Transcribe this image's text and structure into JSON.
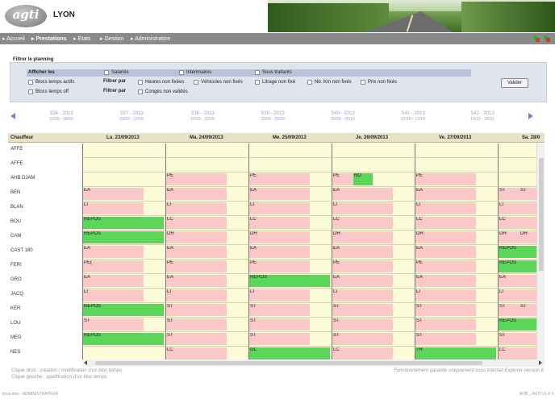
{
  "header": {
    "logo_text": "agti",
    "logo_subtext": "TRANSPORT",
    "city": "LYON"
  },
  "nav": {
    "items": [
      "Accueil",
      "Prestations",
      "Etats",
      "Gestion",
      "Administration"
    ],
    "active": "Prestations"
  },
  "filter": {
    "title": "Filtrer le planning",
    "afficher_label": "Afficher les",
    "filtrer_par_label": "Filtrer par",
    "checkboxes": {
      "salaries": "Salariés",
      "interimaires": "Intérimaires",
      "sous_traitants": "Sous traitants",
      "blocs_actifs": "Blocs temps actifs",
      "blocs_off": "Blocs temps off",
      "heures_non_fixees": "Heures non fixées",
      "vehicules_non_fixes": "Véhicules non fixés",
      "litrage_non_fixe": "Litrage non fixé",
      "km_non_fixes": "Nb. Km non fixés",
      "prix_non_fixes": "Prix non fixés",
      "conges_non_valides": "Congés non validés"
    },
    "valider_label": "Valider"
  },
  "weeks": [
    {
      "label": "S36 - 2013",
      "dates": "02/09 - 08/09"
    },
    {
      "label": "S37 - 2013",
      "dates": "09/09 - 15/09"
    },
    {
      "label": "S38 - 2013",
      "dates": "16/09 - 22/09"
    },
    {
      "label": "S39 - 2013",
      "dates": "23/09 - 29/09"
    },
    {
      "label": "S40 - 2013",
      "dates": "30/09 - 06/10"
    },
    {
      "label": "S41 - 2013",
      "dates": "07/10 - 13/10"
    },
    {
      "label": "S42 - 2013",
      "dates": "14/10 - 20/10"
    }
  ],
  "grid": {
    "chauffeur_header": "Chauffeur",
    "days": [
      "Lu. 23/09/2013",
      "Ma. 24/09/2013",
      "Me. 25/09/2013",
      "Je. 26/09/2013",
      "Ve. 27/09/2013",
      "Sa. 28/0"
    ],
    "chauffeurs": [
      "AFFE",
      "AFFE",
      "AHB DJAM",
      "BEN",
      "BLAN",
      "BOU",
      "CAM",
      "CAST 180",
      "FERI",
      "GRO",
      "JACQ",
      "KER",
      "LOU",
      "MEG",
      "NES"
    ],
    "rows": [
      [
        null,
        null,
        null,
        null,
        null,
        null
      ],
      [
        null,
        null,
        null,
        null,
        null,
        null
      ],
      [
        null,
        {
          "text": "PE",
          "color": "pink"
        },
        {
          "text": "PE",
          "color": "pink"
        },
        {
          "text": "PE",
          "color": "pink",
          "extra": {
            "text": "NO",
            "color": "green"
          }
        },
        {
          "text": "PE",
          "color": "pink"
        },
        null
      ],
      [
        {
          "text": "EA",
          "color": "pink"
        },
        {
          "text": "EA",
          "color": "pink"
        },
        {
          "text": "EA",
          "color": "pink"
        },
        {
          "text": "EA",
          "color": "pink"
        },
        {
          "text": "EA",
          "color": "pink"
        },
        {
          "text": "ST",
          "color": "pink",
          "extra": {
            "text": "ST",
            "color": "pink"
          }
        }
      ],
      [
        {
          "text": "LI",
          "color": "pink"
        },
        {
          "text": "LI",
          "color": "pink"
        },
        {
          "text": "LI",
          "color": "pink"
        },
        {
          "text": "LI",
          "color": "pink"
        },
        {
          "text": "LI",
          "color": "pink"
        },
        {
          "text": "LI",
          "color": "pink"
        }
      ],
      [
        {
          "text": "REPOS",
          "color": "green"
        },
        {
          "text": "LC",
          "color": "pink"
        },
        {
          "text": "LC",
          "color": "pink"
        },
        {
          "text": "LC",
          "color": "pink"
        },
        {
          "text": "LC",
          "color": "pink"
        },
        {
          "text": "LC",
          "color": "pink"
        }
      ],
      [
        {
          "text": "REPOS",
          "color": "green"
        },
        {
          "text": "DH",
          "color": "pink"
        },
        {
          "text": "DH",
          "color": "pink"
        },
        {
          "text": "DH",
          "color": "pink"
        },
        {
          "text": "DH",
          "color": "pink"
        },
        {
          "text": "DH",
          "color": "pink",
          "extra": {
            "text": "DH",
            "color": "pink"
          }
        }
      ],
      [
        {
          "text": "EA",
          "color": "pink"
        },
        {
          "text": "EA",
          "color": "pink"
        },
        {
          "text": "EA",
          "color": "pink"
        },
        {
          "text": "EA",
          "color": "pink"
        },
        {
          "text": "EA",
          "color": "pink"
        },
        {
          "text": "REPOS",
          "color": "green"
        }
      ],
      [
        {
          "text": "PE(",
          "color": "pink"
        },
        {
          "text": "PE",
          "color": "pink"
        },
        {
          "text": "PE",
          "color": "pink"
        },
        {
          "text": "PE",
          "color": "pink"
        },
        {
          "text": "PE",
          "color": "pink"
        },
        {
          "text": "REPOS",
          "color": "green"
        }
      ],
      [
        {
          "text": "EA",
          "color": "pink"
        },
        {
          "text": "EA",
          "color": "pink"
        },
        {
          "text": "REPOS",
          "color": "green"
        },
        {
          "text": "EA",
          "color": "pink"
        },
        {
          "text": "EA",
          "color": "pink"
        },
        {
          "text": "EA",
          "color": "pink"
        }
      ],
      [
        {
          "text": "LI",
          "color": "pink"
        },
        {
          "text": "LI",
          "color": "pink"
        },
        {
          "text": "LI",
          "color": "pink"
        },
        {
          "text": "LI",
          "color": "pink"
        },
        {
          "text": "LI",
          "color": "pink"
        },
        {
          "text": "LI",
          "color": "pink"
        }
      ],
      [
        {
          "text": "REPOS",
          "color": "green"
        },
        {
          "text": "ST",
          "color": "pink"
        },
        {
          "text": "ST",
          "color": "pink"
        },
        {
          "text": "ST",
          "color": "pink"
        },
        {
          "text": "ST",
          "color": "pink"
        },
        {
          "text": "ST",
          "color": "pink",
          "extra": {
            "text": "ST",
            "color": "pink"
          }
        }
      ],
      [
        {
          "text": "ST",
          "color": "pink"
        },
        {
          "text": "ST",
          "color": "pink"
        },
        {
          "text": "ST",
          "color": "pink"
        },
        {
          "text": "ST",
          "color": "pink"
        },
        {
          "text": "ST",
          "color": "pink"
        },
        {
          "text": "REPOS",
          "color": "green"
        }
      ],
      [
        {
          "text": "REPOS",
          "color": "green"
        },
        {
          "text": "ST",
          "color": "pink"
        },
        {
          "text": "ST",
          "color": "pink"
        },
        {
          "text": "ST",
          "color": "pink"
        },
        {
          "text": "ST",
          "color": "pink"
        },
        {
          "text": "ST",
          "color": "pink"
        }
      ],
      [
        null,
        {
          "text": "LC",
          "color": "pink"
        },
        {
          "text": "GL",
          "color": "green"
        },
        {
          "text": "LC",
          "color": "pink"
        },
        {
          "text": "TR",
          "color": "green"
        },
        {
          "text": "LC",
          "color": "pink"
        }
      ]
    ]
  },
  "hints": {
    "right_click": "Clique droit : création / modification d'un bloc temps",
    "left_click": "Clique gauche : qualification d'un bloc temps",
    "disclaimer": "Fonctionnement garantie uniquement sous Internet Explorer version 8"
  },
  "footer": {
    "user": "Vous êtes : ADMINISTRATEUR",
    "version": "ADB _ AGTI v1.4.9"
  },
  "colors": {
    "pink_block": "#fbc8c8",
    "green_block": "#5bd65b",
    "yellow_cell": "#fcfbd7",
    "nav_bg": "#8a8a8a",
    "week_link": "#9aa0d8"
  }
}
